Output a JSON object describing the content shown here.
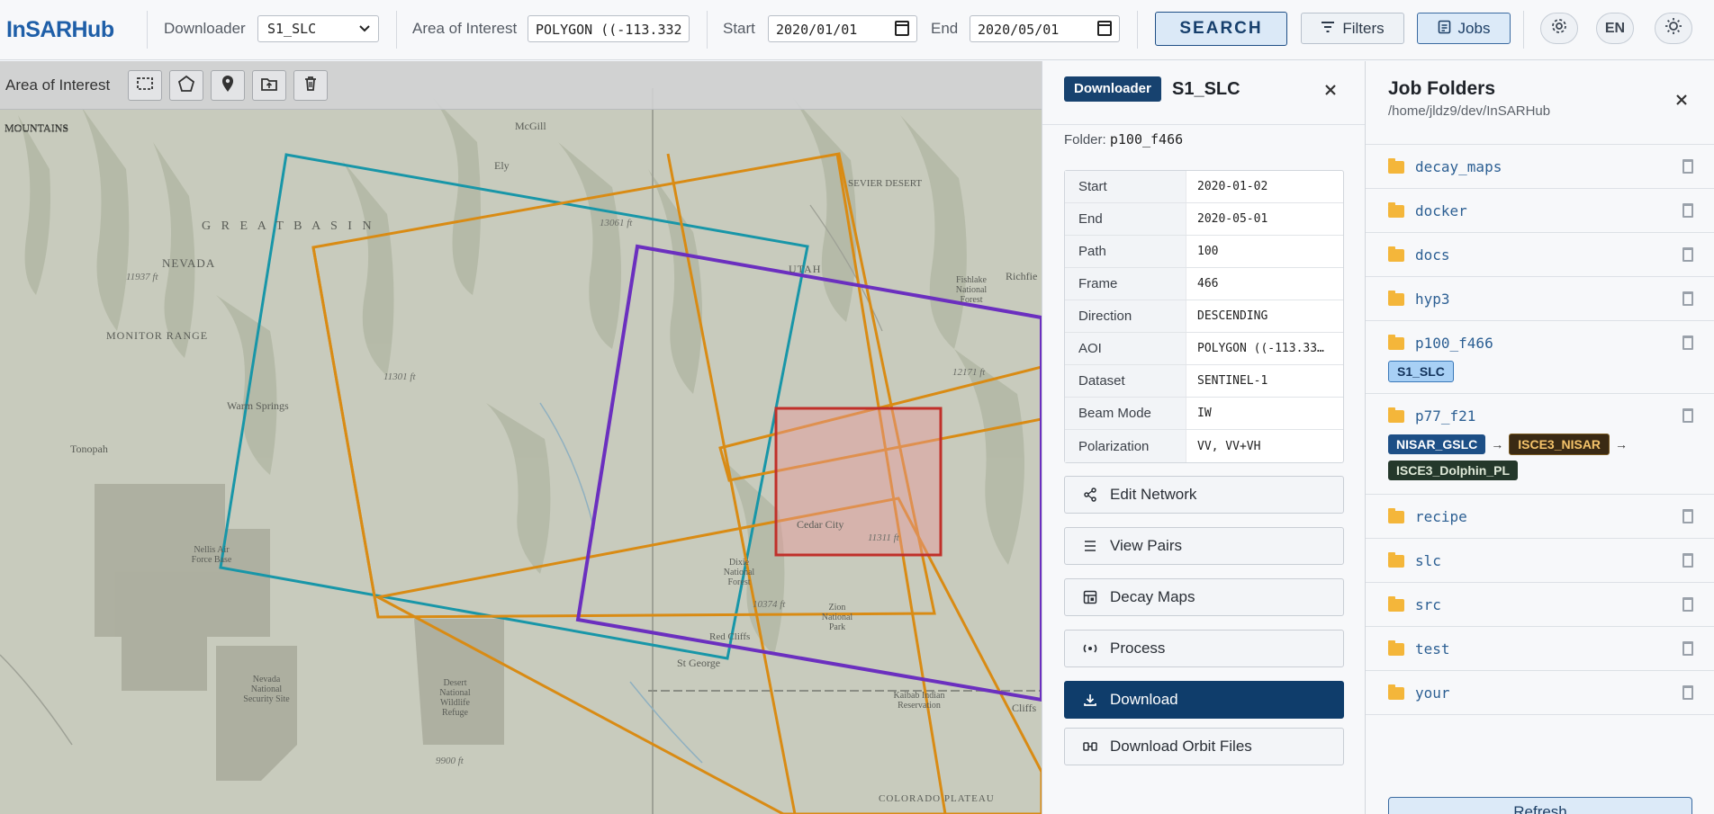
{
  "app": {
    "brand": "InSARHub"
  },
  "topbar": {
    "downloader_label": "Downloader",
    "downloader_value": "S1_SLC",
    "aoi_label": "Area of Interest",
    "aoi_value": "POLYGON ((-113.332",
    "start_label": "Start",
    "start_value": "2020/01/01",
    "end_label": "End",
    "end_value": "2020/05/01",
    "search_label": "SEARCH",
    "filters_label": "Filters",
    "jobs_label": "Jobs",
    "lang_label": "EN"
  },
  "map": {
    "toolbar_title": "Area of Interest",
    "labels": {
      "mountains": "MOUNTAINS",
      "mcgill": "McGill",
      "ely": "Ely",
      "great_basin": "G R E A T   B A S I N",
      "nevada": "NEVADA",
      "elev_11937": "11937 ft",
      "monitor_range": "MONITOR RANGE",
      "elev_13061": "13061 ft",
      "sevier_desert": "SEVIER DESERT",
      "utah": "UTAH",
      "fishlake": "Fishlake National Forest",
      "richfield": "Richfie",
      "elev_11301": "11301 ft",
      "elev_12171": "12171 ft",
      "warm_springs": "Warm Springs",
      "tonopah": "Tonopah",
      "nellis": "Nellis Air Force Base",
      "cedar_city": "Cedar City",
      "elev_11311": "11311 ft",
      "dixie": "Dixie National Forest",
      "elev_10374": "10374 ft",
      "zion": "Zion National Park",
      "red_cliffs": "Red Cliffs",
      "st_george": "St George",
      "nevada_security": "Nevada National Security Site",
      "desert_refuge": "Desert National Wildlife Refuge",
      "kaibab": "Kaibab Indian Reservation",
      "elev_9900": "9900 ft",
      "colorado": "COLORADO PLATEAU",
      "cliffs": "Cliffs"
    },
    "colors": {
      "track_teal": "#1896a8",
      "track_orange": "#d98b14",
      "track_purple": "#6b2fbf",
      "aoi_red": "#c0302a"
    }
  },
  "downloader": {
    "badge": "Downloader",
    "title": "S1_SLC",
    "folder_label": "Folder:",
    "folder_value": "p100_f466",
    "rows": [
      {
        "k": "Start",
        "v": "2020-01-02"
      },
      {
        "k": "End",
        "v": "2020-05-01"
      },
      {
        "k": "Path",
        "v": "100"
      },
      {
        "k": "Frame",
        "v": "466"
      },
      {
        "k": "Direction",
        "v": "DESCENDING"
      },
      {
        "k": "AOI",
        "v": "POLYGON ((-113.33…"
      },
      {
        "k": "Dataset",
        "v": "SENTINEL-1"
      },
      {
        "k": "Beam Mode",
        "v": "IW"
      },
      {
        "k": "Polarization",
        "v": "VV, VV+VH"
      }
    ],
    "actions": {
      "edit_network": "Edit Network",
      "view_pairs": "View Pairs",
      "decay_maps": "Decay Maps",
      "process": "Process",
      "download": "Download",
      "download_orbit": "Download Orbit Files"
    }
  },
  "jobs": {
    "title": "Job Folders",
    "path": "/home/jldz9/dev/InSARHub",
    "folders": [
      "decay_maps",
      "docker",
      "docs",
      "hyp3",
      "p100_f466",
      "p77_f21",
      "recipe",
      "slc",
      "src",
      "test",
      "your"
    ],
    "p100_tag": "S1_SLC",
    "p77_tags": {
      "t1": "NISAR_GSLC",
      "t2": "ISCE3_NISAR",
      "t3": "ISCE3_Dolphin_PL",
      "arrow": "→"
    },
    "refresh": "Refresh"
  }
}
